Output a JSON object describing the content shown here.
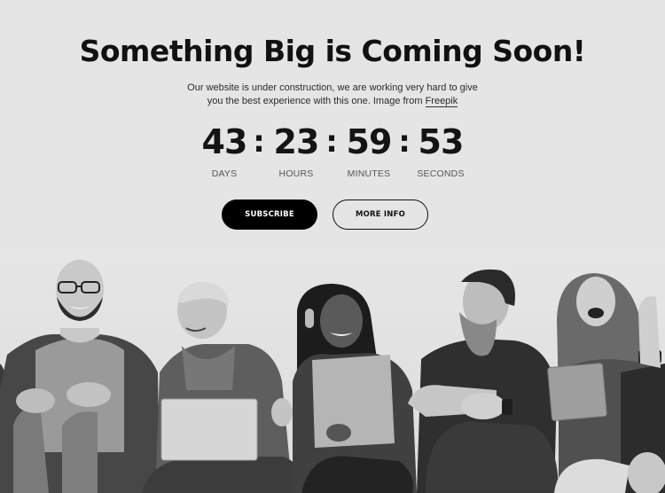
{
  "hero": {
    "title": "Something Big is Coming Soon!",
    "subtitle_line1": "Our website is under construction, we are working very hard to give",
    "subtitle_line2": "you the best experience with this one. Image from ",
    "link_text": "Freepik"
  },
  "countdown": {
    "separator": ":",
    "units": [
      {
        "value": "43",
        "label": "DAYS"
      },
      {
        "value": "23",
        "label": "HOURS"
      },
      {
        "value": "59",
        "label": "MINUTES"
      },
      {
        "value": "53",
        "label": "SECONDS"
      }
    ]
  },
  "buttons": {
    "subscribe": "SUBSCRIBE",
    "more_info": "MORE INFO"
  },
  "image": {
    "description": "Black and white photo of five smiling people sitting against a wall with a laptop, headphones and a tablet"
  },
  "colors": {
    "background": "#e5e5e5",
    "primary": "#000000",
    "text": "#111111"
  }
}
